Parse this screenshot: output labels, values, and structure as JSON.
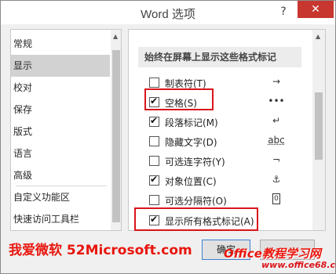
{
  "window": {
    "title": "Word 选项",
    "help": "?",
    "close": "✕"
  },
  "nav": {
    "items": [
      {
        "label": "常规"
      },
      {
        "label": "显示",
        "active": true
      },
      {
        "label": "校对"
      },
      {
        "label": "保存"
      },
      {
        "label": "版式"
      },
      {
        "label": "语言"
      },
      {
        "label": "高级"
      },
      {
        "label": "自定义功能区"
      },
      {
        "label": "快速访问工具栏"
      }
    ]
  },
  "content": {
    "section_title": "始终在屏幕上显示这些格式标记",
    "options": [
      {
        "label": "制表符(T)",
        "checked": false,
        "symbol": "→"
      },
      {
        "label": "空格(S)",
        "checked": true,
        "symbol": "•••"
      },
      {
        "label": "段落标记(M)",
        "checked": true,
        "symbol": "↵"
      },
      {
        "label": "隐藏文字(D)",
        "checked": false,
        "symbol": "abc"
      },
      {
        "label": "可选连字符(Y)",
        "checked": false,
        "symbol": "¬"
      },
      {
        "label": "对象位置(C)",
        "checked": true,
        "symbol": "⚓"
      },
      {
        "label": "可选分隔符(O)",
        "checked": false,
        "symbol": "0"
      },
      {
        "label": "显示所有格式标记(A)",
        "checked": true,
        "symbol": ""
      }
    ]
  },
  "buttons": {
    "ok": "确定"
  },
  "watermark": {
    "left": "我爱微软 52Microsoft.com",
    "right": "Office教程学习网",
    "url": "www.office68.com"
  },
  "colors": {
    "highlight": "#d9141b",
    "close": "#c7372f",
    "watermark": "#e8160e"
  }
}
